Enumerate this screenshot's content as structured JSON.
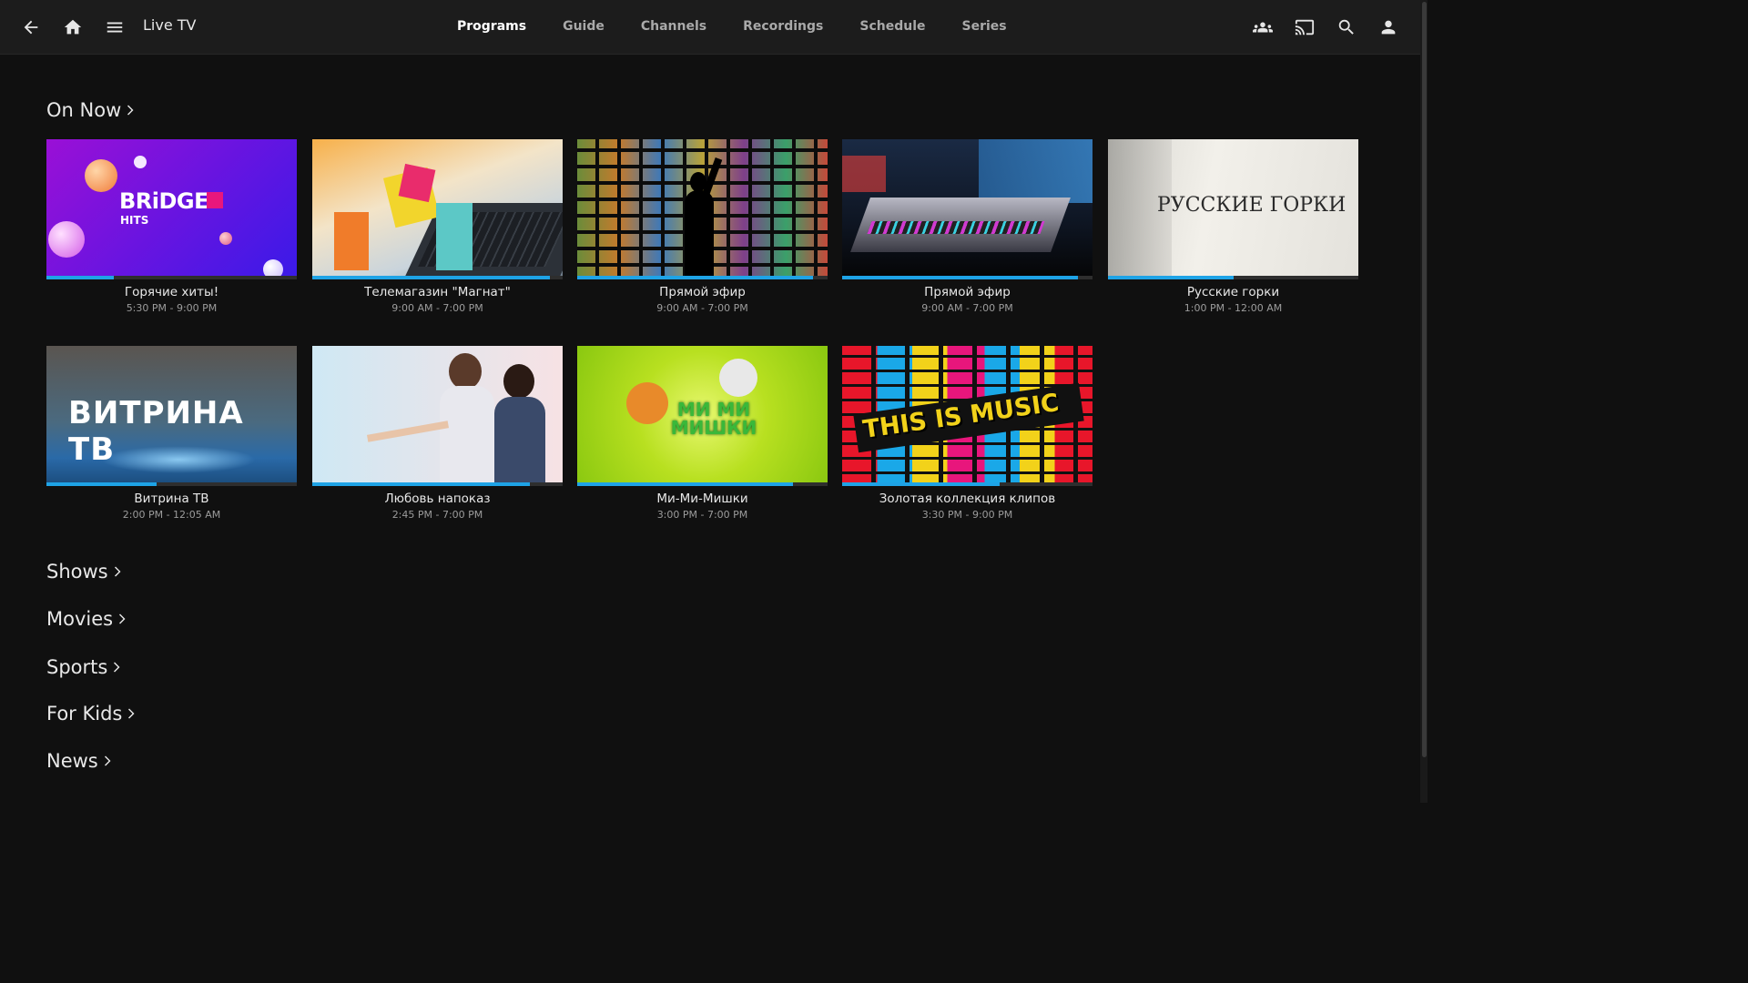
{
  "header": {
    "title": "Live TV",
    "tabs": [
      {
        "label": "Programs",
        "active": true
      },
      {
        "label": "Guide",
        "active": false
      },
      {
        "label": "Channels",
        "active": false
      },
      {
        "label": "Recordings",
        "active": false
      },
      {
        "label": "Schedule",
        "active": false
      },
      {
        "label": "Series",
        "active": false
      }
    ],
    "left_icons": [
      "back-arrow-icon",
      "home-icon",
      "hamburger-menu-icon"
    ],
    "right_icons": [
      "users-icon",
      "cast-icon",
      "search-icon",
      "user-account-icon"
    ]
  },
  "on_now": {
    "heading": "On Now",
    "programs": [
      {
        "title": "Горячие хиты!",
        "time": "5:30 PM - 9:00 PM",
        "progress": 0.27,
        "art_text": "BRiDGE",
        "art_subtext": "HITS"
      },
      {
        "title": "Телемагазин \"Магнат\"",
        "time": "9:00 AM - 7:00 PM",
        "progress": 0.95
      },
      {
        "title": "Прямой эфир",
        "time": "9:00 AM - 7:00 PM",
        "progress": 0.94
      },
      {
        "title": "Прямой эфир",
        "time": "9:00 AM - 7:00 PM",
        "progress": 0.94
      },
      {
        "title": "Русские горки",
        "time": "1:00 PM - 12:00 AM",
        "progress": 0.5,
        "art_text": "РУССКИЕ ГОРКИ"
      },
      {
        "title": "Витрина ТВ",
        "time": "2:00 PM - 12:05 AM",
        "progress": 0.44,
        "art_text": "ВИТРИНА ТВ"
      },
      {
        "title": "Любовь напоказ",
        "time": "2:45 PM - 7:00 PM",
        "progress": 0.87
      },
      {
        "title": "Ми-Ми-Мишки",
        "time": "3:00 PM - 7:00 PM",
        "progress": 0.86,
        "art_text": "МИ МИ МИШКИ"
      },
      {
        "title": "Золотая коллекция клипов",
        "time": "3:30 PM - 9:00 PM",
        "progress": 0.63,
        "art_text": "THIS IS MUSIC"
      }
    ]
  },
  "categories": [
    {
      "label": "Shows"
    },
    {
      "label": "Movies"
    },
    {
      "label": "Sports"
    },
    {
      "label": "For Kids"
    },
    {
      "label": "News"
    }
  ],
  "colors": {
    "accent": "#1ea3e6",
    "background": "#101010",
    "header": "#1c1c1c"
  }
}
